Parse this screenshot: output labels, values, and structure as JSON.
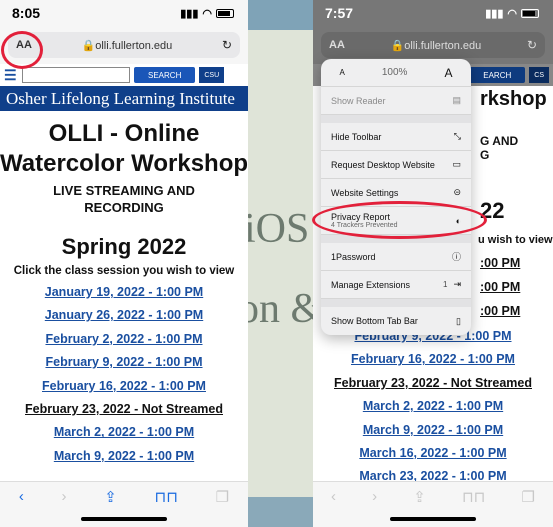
{
  "background": {
    "text1": "iOS",
    "text2": "on &"
  },
  "left": {
    "status_time": "8:05",
    "aa": "AA",
    "url": "olli.fullerton.edu",
    "search_label": "SEARCH",
    "csu": "CSU",
    "banner": "Osher Lifelong Learning Institute",
    "title_line1": "OLLI - Online",
    "title_line2": "Watercolor Workshop",
    "subtitle_line1": "LIVE STREAMING AND",
    "subtitle_line2": "RECORDING",
    "season": "Spring 2022",
    "instruction": "Click the class session you wish to view",
    "sessions": [
      "January 19, 2022 - 1:00 PM",
      "January 26, 2022 - 1:00 PM",
      "February 2, 2022 - 1:00 PM",
      "February 9, 2022 - 1:00 PM",
      "February 16, 2022 - 1:00 PM",
      "February 23, 2022 - Not Streamed",
      "March 2, 2022 - 1:00 PM",
      "March 9, 2022 - 1:00 PM"
    ]
  },
  "right": {
    "status_time": "7:57",
    "aa": "AA",
    "url": "olli.fullerton.edu",
    "search_label": "EARCH",
    "csu": "CS",
    "frag_title1": "rkshop",
    "frag_sub1": "G AND",
    "frag_sub2": "G",
    "frag_season": "22",
    "frag_instruction": "u wish to view",
    "frag_sessions": [
      ":00 PM",
      ":00 PM",
      ":00 PM"
    ],
    "sessions": [
      "February 9, 2022 - 1:00 PM",
      "February 16, 2022 - 1:00 PM",
      "February 23, 2022 - Not Streamed",
      "March 2, 2022 - 1:00 PM",
      "March 9, 2022 - 1:00 PM",
      "March 16, 2022 - 1:00 PM",
      "March 23, 2022 - 1:00 PM"
    ],
    "popup": {
      "zoom_small": "A",
      "zoom_value": "100%",
      "zoom_large": "A",
      "items": [
        {
          "label": "Show Reader",
          "icon": "reader-icon",
          "glyph": "▤",
          "dimmed": true
        },
        {
          "label": "Hide Toolbar",
          "icon": "resize-icon",
          "glyph": "⤡"
        },
        {
          "label": "Request Desktop Website",
          "icon": "desktop-icon",
          "glyph": "▭"
        },
        {
          "label": "Website Settings",
          "icon": "settings-icon",
          "glyph": "⊝"
        },
        {
          "label": "Privacy Report",
          "sub": "4 Trackers Prevented",
          "icon": "shield-icon",
          "glyph": "◐"
        },
        {
          "label": "1Password",
          "icon": "onepassword-icon",
          "glyph": "ⓘ"
        },
        {
          "label": "Manage Extensions",
          "badge": "1",
          "icon": "extensions-icon",
          "glyph": "⇥"
        },
        {
          "label": "Show Bottom Tab Bar",
          "icon": "tabbar-icon",
          "glyph": "▯"
        }
      ]
    }
  },
  "colors": {
    "link": "#1a4fa0",
    "banner": "#0f3f8a",
    "annotation": "#e2203a"
  }
}
